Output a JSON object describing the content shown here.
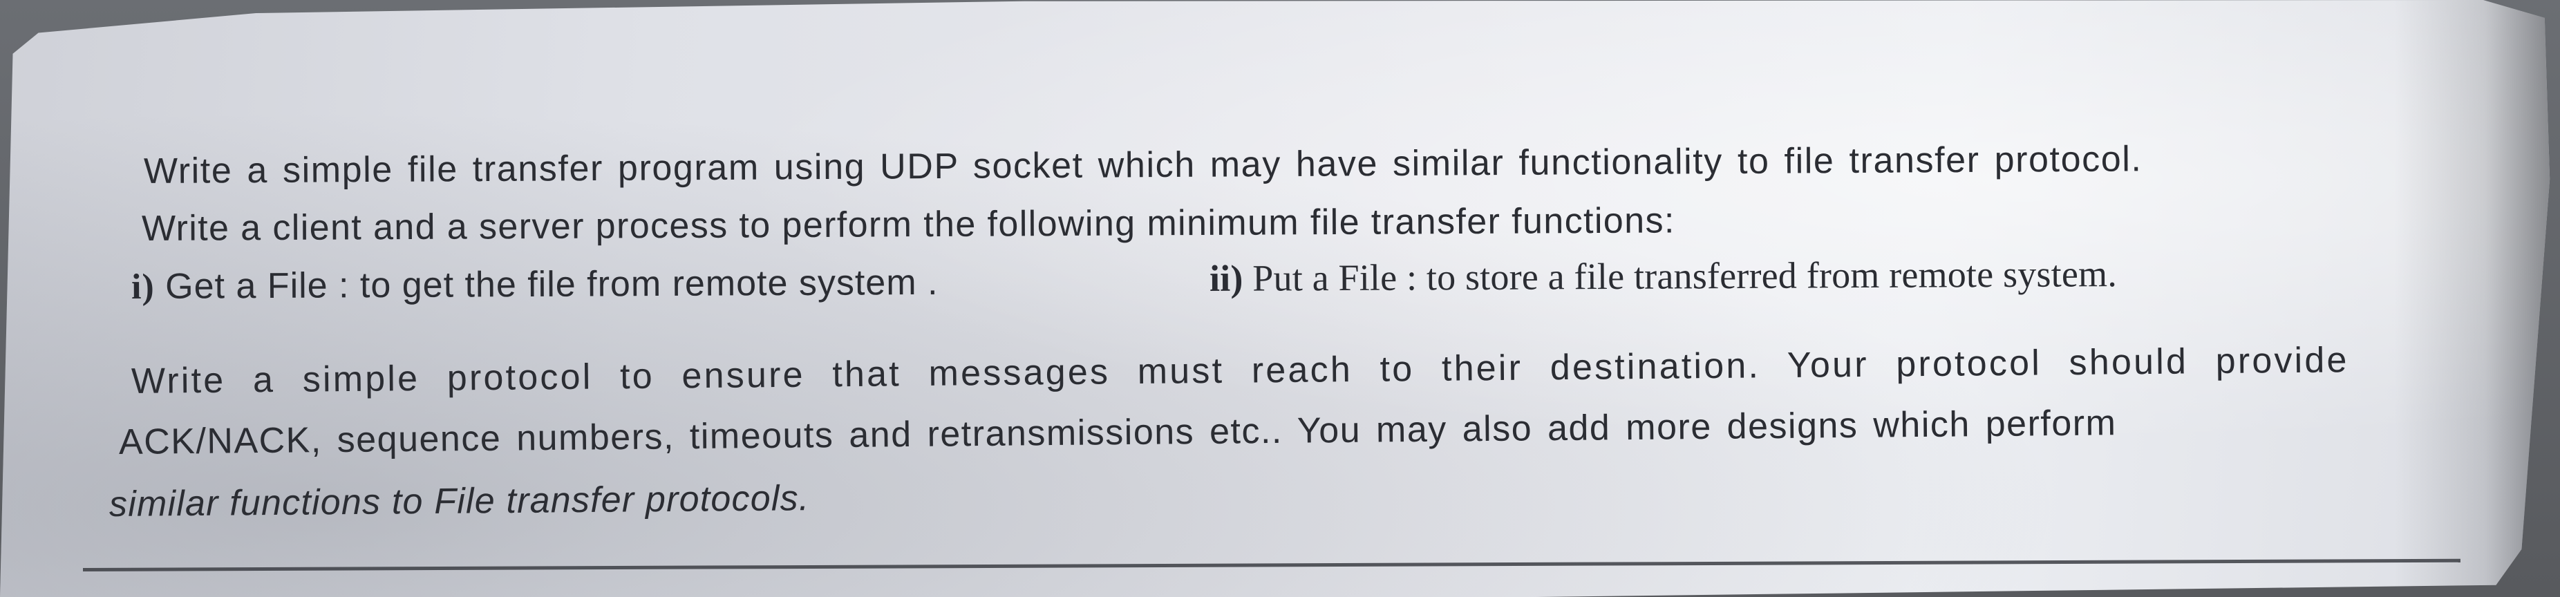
{
  "question": {
    "paragraph1": {
      "line1": "Write a simple file transfer program using UDP socket which may have similar functionality to file transfer protocol.",
      "line2": "Write a client and a server process to perform the following minimum file transfer functions:",
      "item1_num": "i)",
      "item1_text": " Get a File : to get the file from remote system   .",
      "item2_num": "ii)",
      "item2_text": " Put a File : to store a file transferred from remote system."
    },
    "paragraph2": {
      "line1": "Write a simple protocol to ensure that messages must reach to their destination. Your protocol should provide",
      "line2": "ACK/NACK, sequence numbers, timeouts and retransmissions etc.. You may also add more designs which perform",
      "line3": "similar functions to File transfer protocols."
    }
  }
}
